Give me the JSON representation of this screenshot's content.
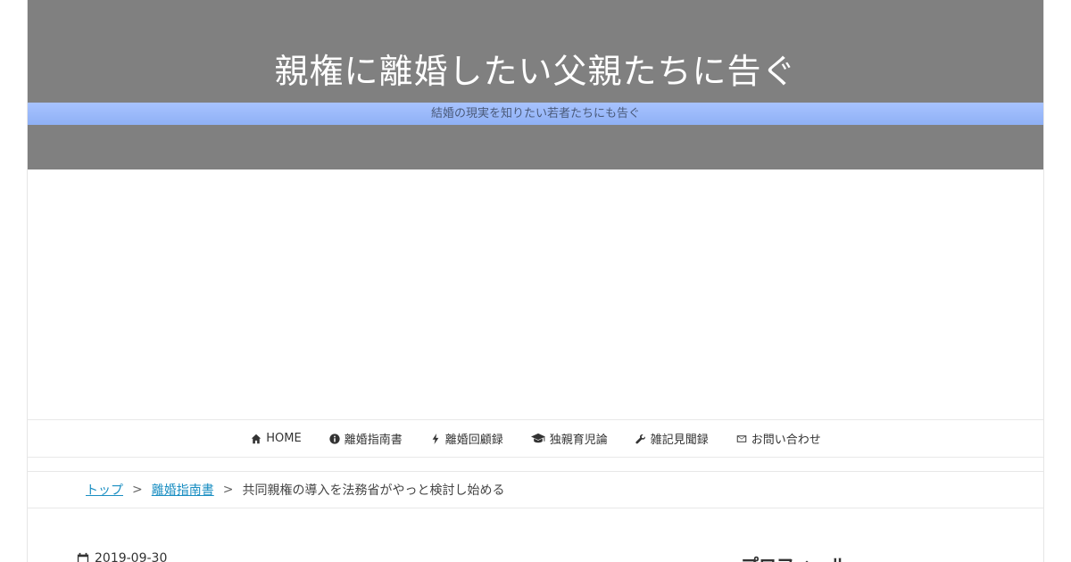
{
  "header": {
    "site_title": "親権に離婚したい父親たちに告ぐ",
    "tagline": "結婚の現実を知りたい若者たちにも告ぐ",
    "bg_color": "#808080",
    "tagline_band_color": "#9fbcff"
  },
  "nav": {
    "items": [
      {
        "label": "HOME",
        "icon": "home-icon"
      },
      {
        "label": "離婚指南書",
        "icon": "info-circle-icon"
      },
      {
        "label": "離婚回顧録",
        "icon": "bolt-icon"
      },
      {
        "label": "独親育児論",
        "icon": "graduation-cap-icon"
      },
      {
        "label": "雑記見聞録",
        "icon": "wrench-icon"
      },
      {
        "label": "お問い合わせ",
        "icon": "envelope-icon"
      }
    ]
  },
  "breadcrumb": {
    "top": "トップ",
    "category": "離婚指南書",
    "separator": ">",
    "current": "共同親権の導入を法務省がやっと検討し始める",
    "link_color": "#1a8ec2"
  },
  "post": {
    "date": "2019-09-30"
  },
  "sidebar": {
    "heading": "プロフィール"
  }
}
